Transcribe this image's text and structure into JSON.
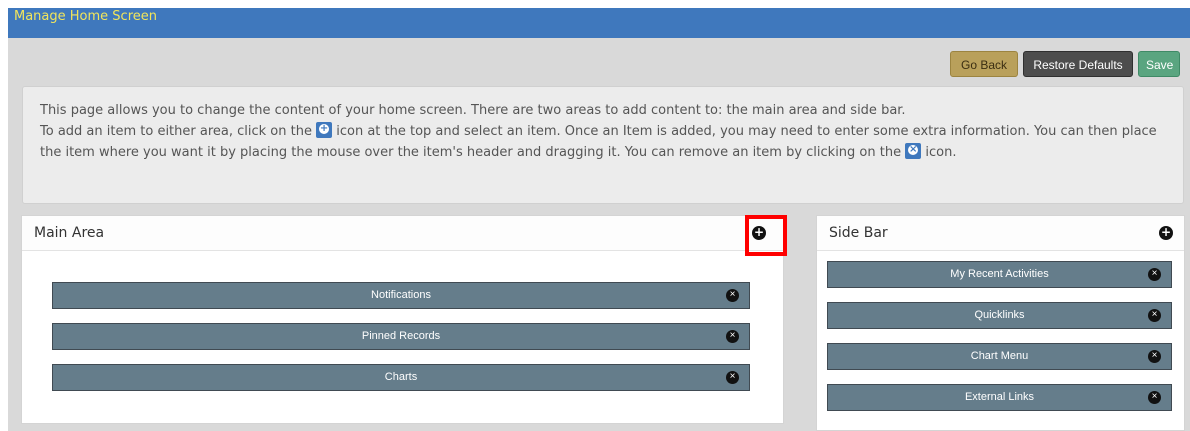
{
  "title": "Manage Home Screen",
  "toolbar": {
    "go_back": "Go Back",
    "restore_defaults": "Restore Defaults",
    "save": "Save"
  },
  "info": {
    "line1": "This page allows you to change the content of your home screen. There are two areas to add content to: the main area and side bar.",
    "line2_a": "To add an item to either area, click on the",
    "line2_b": "icon at the top and select an item. Once an Item is added, you may need to enter some extra information. You can then place the item where you want it by placing the mouse over the item's header and dragging it. You can remove an item by clicking on the",
    "line2_c": "icon."
  },
  "main_area": {
    "title": "Main Area",
    "items": [
      "Notifications",
      "Pinned Records",
      "Charts"
    ]
  },
  "side_bar": {
    "title": "Side Bar",
    "items": [
      "My Recent Activities",
      "Quicklinks",
      "Chart Menu",
      "External Links"
    ]
  },
  "icons": {
    "add": "plus-circle-icon",
    "remove": "times-circle-icon"
  },
  "colors": {
    "header_bar": "#3f78bd",
    "title_text": "#f2e55b",
    "item_bg": "#657d8b",
    "go_back": "#b9a05b",
    "restore": "#4d4d4d",
    "save": "#5aa580",
    "highlight": "#ff0000"
  }
}
